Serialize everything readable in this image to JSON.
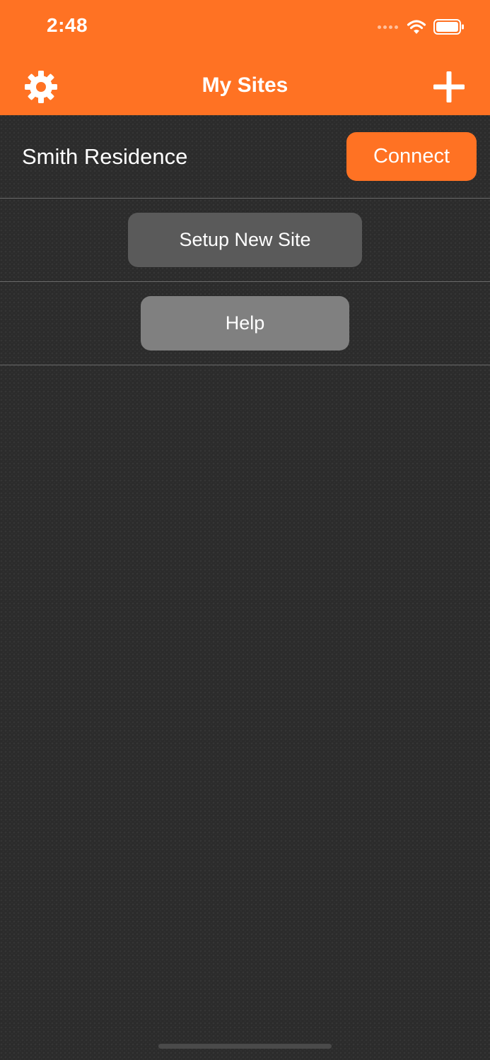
{
  "status_bar": {
    "time": "2:48"
  },
  "nav_bar": {
    "title": "My Sites",
    "left_icon": "gear-icon",
    "right_icon": "plus-icon"
  },
  "sites": [
    {
      "name": "Smith Residence",
      "action_label": "Connect"
    }
  ],
  "actions": {
    "setup_label": "Setup New Site",
    "help_label": "Help"
  },
  "colors": {
    "accent": "#ff7223",
    "background": "#2b2b2b",
    "setup_button": "#5a5a5a",
    "help_button": "#808080"
  }
}
